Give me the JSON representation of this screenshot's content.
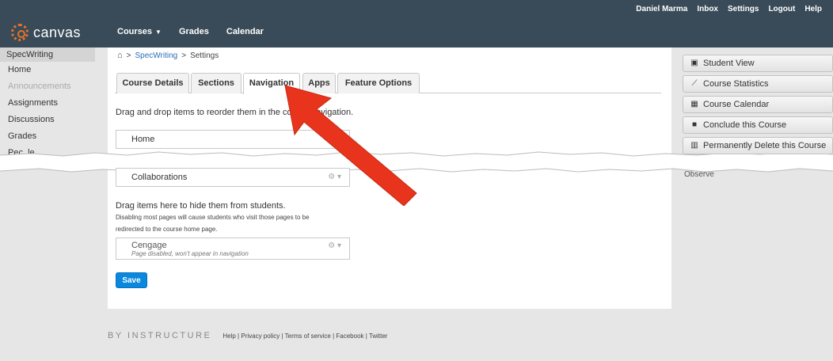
{
  "header": {
    "logo_text": "canvas",
    "user_nav": [
      "Daniel Marma",
      "Inbox",
      "Settings",
      "Logout",
      "Help"
    ],
    "main_nav": [
      {
        "label": "Courses",
        "has_dropdown": true
      },
      {
        "label": "Grades",
        "has_dropdown": false
      },
      {
        "label": "Calendar",
        "has_dropdown": false
      }
    ]
  },
  "sidebar": {
    "course_name": "SpecWriting",
    "items": [
      {
        "label": "Home",
        "disabled": false
      },
      {
        "label": "Announcements",
        "disabled": true
      },
      {
        "label": "Assignments",
        "disabled": false
      },
      {
        "label": "Discussions",
        "disabled": false
      },
      {
        "label": "Grades",
        "disabled": false
      },
      {
        "label": "Pec. le",
        "disabled": false
      }
    ]
  },
  "breadcrumb": {
    "home_icon": "home-icon",
    "separator": ">",
    "course": "SpecWriting",
    "page": "Settings"
  },
  "tabs": [
    "Course Details",
    "Sections",
    "Navigation",
    "Apps",
    "Feature Options"
  ],
  "active_tab": "Navigation",
  "navigation": {
    "instruction": "Drag and drop items to reorder them in the course navigation.",
    "enabled_items": [
      "Home",
      "Collaborations"
    ],
    "hide_heading": "Drag items here to hide them from students.",
    "hide_note_line1": "Disabling most pages will cause students who visit those pages to be",
    "hide_note_line2": "redirected to the course home page.",
    "disabled_items": [
      {
        "name": "Cengage",
        "note": "Page disabled, won't appear in navigation"
      }
    ],
    "save_label": "Save"
  },
  "right_sidebar": {
    "buttons": [
      {
        "label": "Student View",
        "icon": "person-card-icon"
      },
      {
        "label": "Course Statistics",
        "icon": "line-chart-icon"
      },
      {
        "label": "Course Calendar",
        "icon": "calendar-icon"
      },
      {
        "label": "Conclude this Course",
        "icon": "lock-icon"
      },
      {
        "label": "Permanently Delete this Course",
        "icon": "trash-icon"
      }
    ],
    "observe_text": "Observe"
  },
  "footer": {
    "brand": "BY INSTRUCTURE",
    "links": "Help | Privacy policy | Terms of service | Facebook | Twitter"
  },
  "colors": {
    "header_bg": "#394b58",
    "link": "#2a6fb6",
    "save_button": "#0a88de",
    "arrow": "#e8341c",
    "logo_accent": "#e4722b"
  }
}
